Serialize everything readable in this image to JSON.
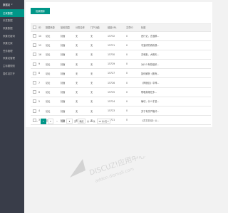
{
  "sidebar": {
    "header": "数据站",
    "items": [
      {
        "label": "已采数据",
        "active": true
      },
      {
        "label": "未发数据",
        "active": false
      },
      {
        "label": "采集数据",
        "active": false
      },
      {
        "label": "采集关键词",
        "active": false
      },
      {
        "label": "采集文案",
        "active": false
      },
      {
        "label": "任务管理",
        "active": false
      },
      {
        "label": "采集站管理",
        "active": false
      },
      {
        "label": "主标题规则",
        "active": false
      },
      {
        "label": "插件站打开",
        "active": false
      }
    ]
  },
  "toolbar": {
    "batch_delete_label": "批量删除"
  },
  "table": {
    "columns": [
      "ID",
      "数据来源",
      "接收范围",
      "分类名称",
      "门户功能",
      "链接URL",
      "文章ID",
      "标题"
    ],
    "rows": [
      {
        "id": "10",
        "type": "论坛",
        "scope": "封面",
        "cat": "无",
        "feature": "无",
        "url": "15732",
        "count": "0",
        "title": "西行记，去湿群..."
      },
      {
        "id": "12",
        "type": "论坛",
        "scope": "封面",
        "cat": "无",
        "feature": "无",
        "url": "15731",
        "count": "0",
        "title": "冬宝研究看着观..."
      },
      {
        "id": "16",
        "type": "论坛",
        "scope": "封面",
        "cat": "无",
        "feature": "无",
        "url": "15730",
        "count": "0",
        "title": "灵魂拒，大概天..."
      },
      {
        "id": "9",
        "type": "论坛",
        "scope": "封面",
        "cat": "无",
        "feature": "无",
        "url": "15729",
        "count": "0",
        "title": "为什么有些组织..."
      },
      {
        "id": "8",
        "type": "论坛",
        "scope": "封面",
        "cat": "无",
        "feature": "无",
        "url": "15727",
        "count": "0",
        "title": "如何解析《蛋壳..."
      },
      {
        "id": "7",
        "type": "论坛",
        "scope": "封面",
        "cat": "无",
        "feature": "无",
        "url": "15726",
        "count": "0",
        "title": "《神魔伝》中神..."
      },
      {
        "id": "6",
        "type": "论坛",
        "scope": "封面",
        "cat": "无",
        "feature": "无",
        "url": "15725",
        "count": "0",
        "title": "歌唱英雄在多..."
      },
      {
        "id": "5",
        "type": "论坛",
        "scope": "封面",
        "cat": "无",
        "feature": "无",
        "url": "15724",
        "count": "0",
        "title": "确切，什么才是..."
      },
      {
        "id": "4",
        "type": "论坛",
        "scope": "封面",
        "cat": "无",
        "feature": "无",
        "url": "15723",
        "count": "0",
        "title": "关于有关严格纤..."
      },
      {
        "id": "3",
        "type": "论坛",
        "scope": "封面",
        "cat": "无",
        "feature": "无",
        "url": "15721",
        "count": "0",
        "title": "《古古日记》公..."
      }
    ]
  },
  "pagination": {
    "prev": "<",
    "pages": [
      "1",
      "2"
    ],
    "active_page": "1",
    "next": ">",
    "goto_label": "到第",
    "goto_value": "1",
    "page_unit": "页",
    "confirm_label": "确定",
    "total_text": "共 13 条",
    "page_size": "10 条/页"
  },
  "colors": {
    "sidebar_bg": "#393d49",
    "accent": "#009688",
    "page_bg": "#f2f2f2"
  },
  "watermark": {
    "text": "DISCUZ!应用中心",
    "subtext": "addon.dismall.com"
  }
}
